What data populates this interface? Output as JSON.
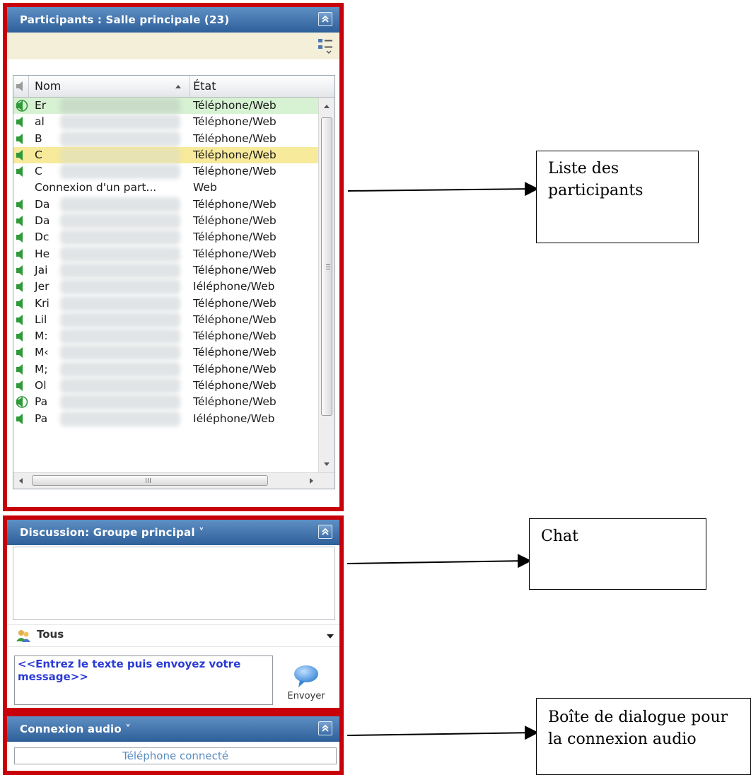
{
  "participants_panel": {
    "title": "Participants : Salle principale (23)",
    "columns": {
      "name": "Nom",
      "state": "État"
    },
    "rows": [
      {
        "name": "Er",
        "state": "Téléphone/Web",
        "icon": "speaking-icon",
        "highlight": "green",
        "blurred": true
      },
      {
        "name": "al",
        "state": "Téléphone/Web",
        "icon": "speaker-icon",
        "highlight": "",
        "blurred": true
      },
      {
        "name": "B",
        "state": "Téléphone/Web",
        "icon": "speaker-icon",
        "highlight": "",
        "blurred": true
      },
      {
        "name": "C",
        "state": "Téléphone/Web",
        "icon": "speaker-icon",
        "highlight": "yellow",
        "blurred": true
      },
      {
        "name": "C",
        "state": "Téléphone/Web",
        "icon": "speaker-icon",
        "highlight": "",
        "blurred": true
      },
      {
        "name": "Connexion d'un part...",
        "state": "Web",
        "icon": "",
        "highlight": "",
        "blurred": false
      },
      {
        "name": "Da",
        "state": "Téléphone/Web",
        "icon": "speaker-icon",
        "highlight": "",
        "blurred": true
      },
      {
        "name": "Da",
        "state": "Téléphone/Web",
        "icon": "speaker-icon",
        "highlight": "",
        "blurred": true
      },
      {
        "name": "Dc",
        "state": "Téléphone/Web",
        "icon": "speaker-icon",
        "highlight": "",
        "blurred": true
      },
      {
        "name": "He",
        "state": "Téléphone/Web",
        "icon": "speaker-icon",
        "highlight": "",
        "blurred": true
      },
      {
        "name": "Jai",
        "state": "Téléphone/Web",
        "icon": "speaker-icon",
        "highlight": "",
        "blurred": true
      },
      {
        "name": "Jer",
        "state": "Iéléphone/Web",
        "icon": "speaker-icon",
        "highlight": "",
        "blurred": true
      },
      {
        "name": "Kri",
        "state": "Téléphone/Web",
        "icon": "speaker-icon",
        "highlight": "",
        "blurred": true
      },
      {
        "name": "Lil",
        "state": "Téléphone/Web",
        "icon": "speaker-icon",
        "highlight": "",
        "blurred": true
      },
      {
        "name": "M:",
        "state": "Téléphone/Web",
        "icon": "speaker-icon",
        "highlight": "",
        "blurred": true
      },
      {
        "name": "M‹",
        "state": "Téléphone/Web",
        "icon": "speaker-icon",
        "highlight": "",
        "blurred": true
      },
      {
        "name": "M;",
        "state": "Téléphone/Web",
        "icon": "speaker-icon",
        "highlight": "",
        "blurred": true
      },
      {
        "name": "Ol",
        "state": "Téléphone/Web",
        "icon": "speaker-icon",
        "highlight": "",
        "blurred": true
      },
      {
        "name": "Pa",
        "state": "Téléphone/Web",
        "icon": "speaking-icon",
        "highlight": "",
        "blurred": true
      },
      {
        "name": "Pa",
        "state": "Iéléphone/Web",
        "icon": "speaker-icon",
        "highlight": "",
        "blurred": true
      }
    ]
  },
  "chat_panel": {
    "title": "Discussion: Groupe principal ˅",
    "recipient": "Tous",
    "input_placeholder": "<<Entrez le texte puis envoyez votre message>>",
    "send_label": "Envoyer"
  },
  "audio_panel": {
    "title": "Connexion audio ˅",
    "status": "Téléphone connecté"
  },
  "callouts": {
    "participants": "Liste des participants",
    "chat": "Chat",
    "audio": "Boîte de dialogue pour la connexion audio"
  },
  "colors": {
    "frame_red": "#c8000a",
    "header_blue": "#2e5f99",
    "speaker_green": "#2f9a3a",
    "highlight_green": "#d6f2d2",
    "highlight_yellow": "#f8ea9b",
    "link_blue": "#2a3bd4"
  }
}
